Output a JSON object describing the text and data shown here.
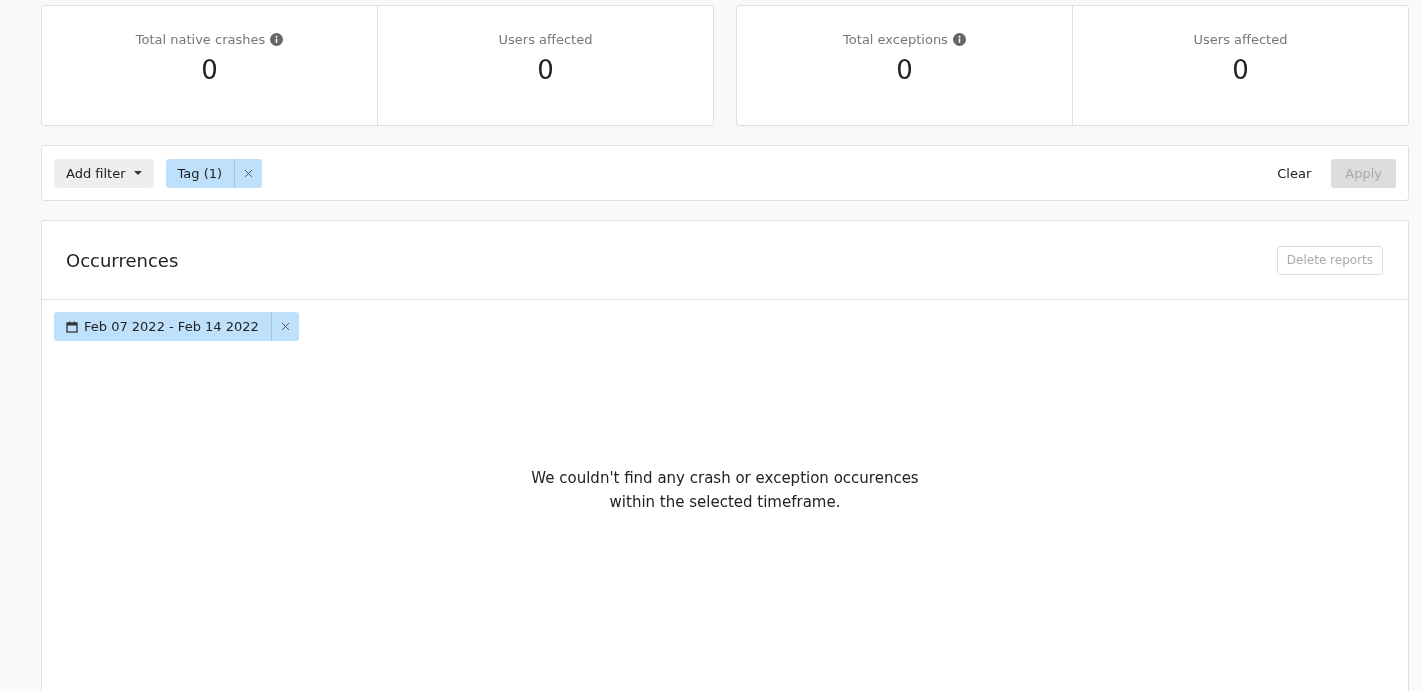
{
  "stat_groups": [
    {
      "stats": [
        {
          "label": "Total native crashes",
          "info": true,
          "value": "0"
        },
        {
          "label": "Users affected",
          "info": false,
          "value": "0"
        }
      ]
    },
    {
      "stats": [
        {
          "label": "Total exceptions",
          "info": true,
          "value": "0"
        },
        {
          "label": "Users affected",
          "info": false,
          "value": "0"
        }
      ]
    }
  ],
  "filter_bar": {
    "add_filter": "Add filter",
    "chips": [
      {
        "label": "Tag (1)"
      }
    ],
    "clear": "Clear",
    "apply": {
      "label": "Apply",
      "disabled": true
    }
  },
  "occurrences": {
    "title": "Occurrences",
    "delete": {
      "label": "Delete reports",
      "disabled": true
    },
    "date_chip": "Feb 07 2022 - Feb 14 2022",
    "empty_lines": [
      "We couldn't find any crash or exception occurences",
      "within the selected timeframe."
    ]
  }
}
